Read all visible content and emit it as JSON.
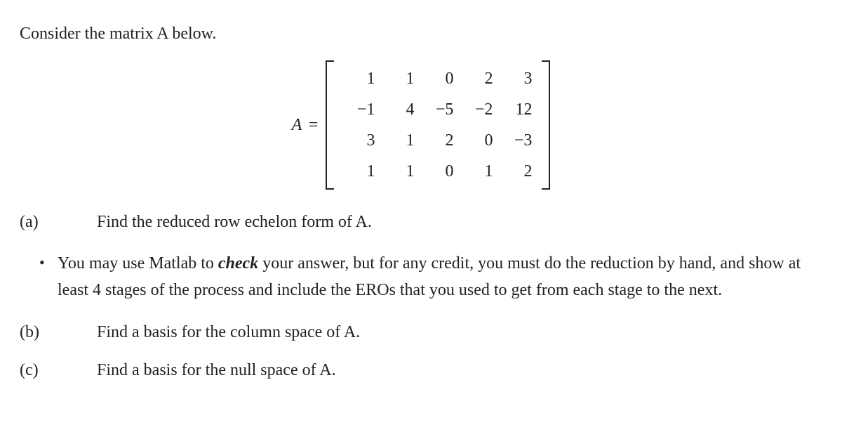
{
  "intro": "Consider the matrix A below.",
  "matrix": {
    "label": "A",
    "eq": "=",
    "rows": [
      [
        "1",
        "1",
        "0",
        "2",
        "3"
      ],
      [
        "−1",
        "4",
        "−5",
        "−2",
        "12"
      ],
      [
        "3",
        "1",
        "2",
        "0",
        "−3"
      ],
      [
        "1",
        "1",
        "0",
        "1",
        "2"
      ]
    ]
  },
  "part_a": {
    "label": "(a)",
    "text": "Find the reduced row echelon form of A."
  },
  "bullet": {
    "dot": "•",
    "pre": "You may use Matlab to ",
    "check": "check",
    "post": " your answer, but for any credit, you must do the reduction by hand, and show at least 4 stages of the process and include the EROs that you used to get from each stage to the next."
  },
  "part_b": {
    "label": "(b)",
    "text": "Find a basis for the column space of A."
  },
  "part_c": {
    "label": "(c)",
    "text": "Find a basis for the null space of A."
  }
}
